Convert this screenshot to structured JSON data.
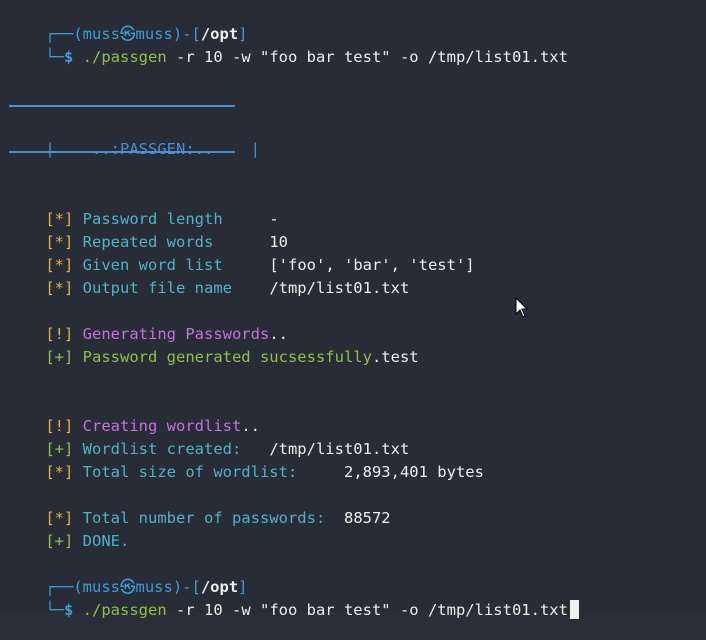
{
  "prompt1": {
    "top_left": "┌──(",
    "user": "muss",
    "at_icon": "㉿",
    "host": "muss",
    "path_open": ")-[",
    "path": "/opt",
    "path_close": "]",
    "bottom_left": "└─",
    "dollar": "$ ",
    "command": "./passgen",
    "args": " -r 10 -w \"foo bar test\" -o /tmp/list01.txt"
  },
  "banner": {
    "left_bar": "|",
    "title": "..:PASSGEN:..",
    "right_bar": "|"
  },
  "info": [
    {
      "marker": "[*]",
      "label": "Password length",
      "value": "-"
    },
    {
      "marker": "[*]",
      "label": "Repeated words",
      "value": "10"
    },
    {
      "marker": "[*]",
      "label": "Given word list",
      "value": "['foo', 'bar', 'test']"
    },
    {
      "marker": "[*]",
      "label": "Output file name",
      "value": "/tmp/list01.txt"
    }
  ],
  "generating": {
    "marker": "[!]",
    "text": "Generating Passwords",
    "dots": ".."
  },
  "generated": {
    "marker": "[+]",
    "text": "Password generated sucsessfully",
    "suffix": ".test"
  },
  "creating": {
    "marker": "[!]",
    "text": "Creating wordlist",
    "dots": ".."
  },
  "wordlist_created": {
    "marker": "[+]",
    "label": "Wordlist created:",
    "value": "/tmp/list01.txt"
  },
  "total_size": {
    "marker": "[*]",
    "label": "Total size of wordlist:",
    "value": "2,893,401 bytes"
  },
  "total_passwords": {
    "marker": "[*]",
    "label": "Total number of passwords:",
    "value": "88572"
  },
  "done": {
    "marker": "[+]",
    "text": "DONE."
  },
  "prompt2": {
    "top_left": "┌──(",
    "user": "muss",
    "at_icon": "㉿",
    "host": "muss",
    "path_open": ")-[",
    "path": "/opt",
    "path_close": "]",
    "bottom_left": "└─",
    "dollar": "$ ",
    "command": "./passgen",
    "args": " -r 10 -w \"foo bar test\" -o /tmp/list01.txt"
  },
  "colors": {
    "background": "#282c36",
    "prompt": "#3d9dd6",
    "marker": "#e0b341",
    "label": "#4fb3c7",
    "success": "#8dc149",
    "warning_text": "#c770e0"
  }
}
